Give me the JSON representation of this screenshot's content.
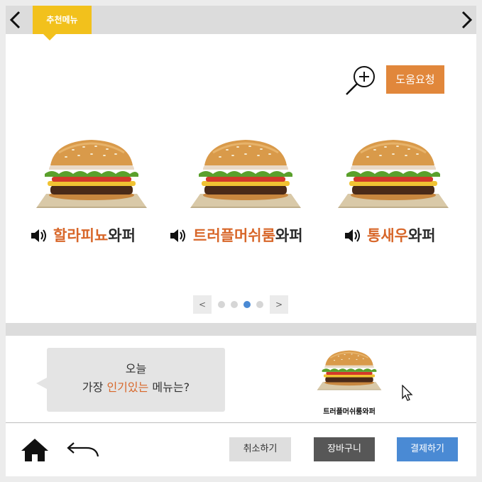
{
  "header": {
    "tag_label": "추천메뉴",
    "prev_icon": "chevron-left-icon",
    "next_icon": "chevron-right-icon"
  },
  "tools": {
    "zoom_icon": "zoom-in-icon",
    "help_label": "도움요청"
  },
  "menu": {
    "items": [
      {
        "highlight": "할라피뇨",
        "rest": "와퍼"
      },
      {
        "highlight": "트러플머쉬룸",
        "rest": "와퍼"
      },
      {
        "highlight": "통새우",
        "rest": "와퍼"
      }
    ]
  },
  "pager": {
    "prev_label": "<",
    "next_label": ">",
    "page_count": 4,
    "current_page": 3
  },
  "recommend": {
    "line1": "오늘",
    "line2_pre": "가장 ",
    "line2_highlight": "인기있는",
    "line2_post": " 메뉴는?",
    "item_label": "트러플머쉬룸와퍼"
  },
  "footer": {
    "home_icon": "home-icon",
    "back_icon": "back-arrow-icon",
    "cancel_label": "취소하기",
    "cart_label": "장바구니",
    "pay_label": "결제하기"
  },
  "colors": {
    "accent_orange": "#d8672a",
    "help_orange": "#e1873b",
    "tag_yellow": "#f2c11c",
    "primary_blue": "#4a8ad4",
    "dark_gray": "#575757"
  }
}
